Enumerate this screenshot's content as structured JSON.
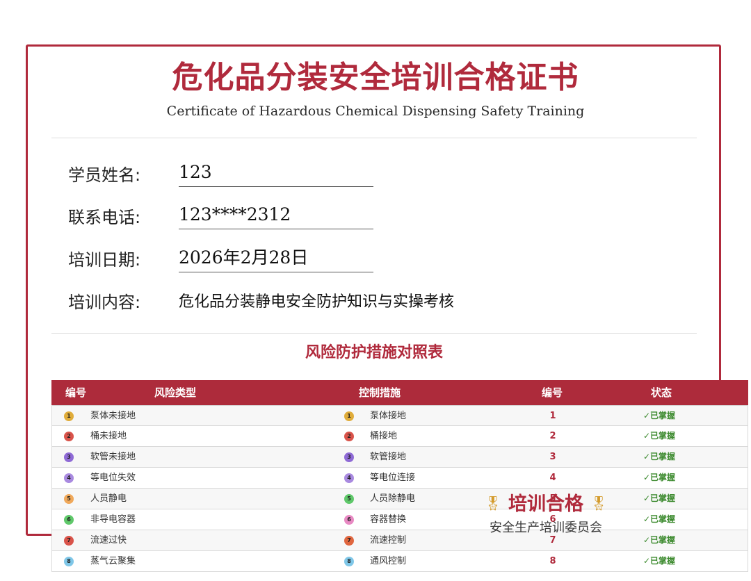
{
  "certificate": {
    "title": "危化品分装安全培训合格证书",
    "subtitle": "Certificate of Hazardous Chemical Dispensing Safety Training",
    "fields": [
      {
        "label": "学员姓名:",
        "value": "123"
      },
      {
        "label": "联系电话:",
        "value": "123****2312"
      },
      {
        "label": "培训日期:",
        "value": "2026年2月28日"
      },
      {
        "label": "培训内容:",
        "value": "危化品分装静电安全防护知识与实操考核"
      }
    ]
  },
  "table": {
    "title": "风险防护措施对照表",
    "headers": [
      "编号",
      "风险类型",
      "控制措施",
      "编号",
      "状态"
    ],
    "rows": [
      {
        "badge": "1",
        "risk": "泵体未接地",
        "control": "泵体接地",
        "num": "1",
        "status": "✓已掌握"
      },
      {
        "badge": "2",
        "risk": "桶未接地",
        "control": "桶接地",
        "num": "2",
        "status": "✓已掌握"
      },
      {
        "badge": "3",
        "risk": "软管未接地",
        "control": "软管接地",
        "num": "3",
        "status": "✓已掌握"
      },
      {
        "badge": "4",
        "risk": "等电位失效",
        "control": "等电位连接",
        "num": "4",
        "status": "✓已掌握"
      },
      {
        "badge": "5",
        "risk": "人员静电",
        "control": "人员除静电",
        "num": "5",
        "status": "✓已掌握"
      },
      {
        "badge": "6",
        "risk": "非导电容器",
        "control": "容器替换",
        "num": "6",
        "status": "✓已掌握"
      },
      {
        "badge": "7",
        "risk": "流速过快",
        "control": "流速控制",
        "num": "7",
        "status": "✓已掌握"
      },
      {
        "badge": "8",
        "risk": "蒸气云聚集",
        "control": "通风控制",
        "num": "8",
        "status": "✓已掌握"
      }
    ],
    "badge_colors_left": [
      "#e0ac3a",
      "#d9534a",
      "#8f6ad6",
      "#a98ae0",
      "#f0a85a",
      "#5fc86a",
      "#d9534a",
      "#7fc7e8"
    ],
    "badge_colors_right": [
      "#e0ac3a",
      "#d9534a",
      "#8f6ad6",
      "#a98ae0",
      "#5fc86a",
      "#e889c3",
      "#e0663f",
      "#7fc7e8"
    ]
  },
  "seal": {
    "title": "培训合格",
    "issuer": "安全生产培训委员会",
    "icon": "medal-icon"
  },
  "colors": {
    "accent": "#b02a3c",
    "status": "#3c8a2e"
  }
}
